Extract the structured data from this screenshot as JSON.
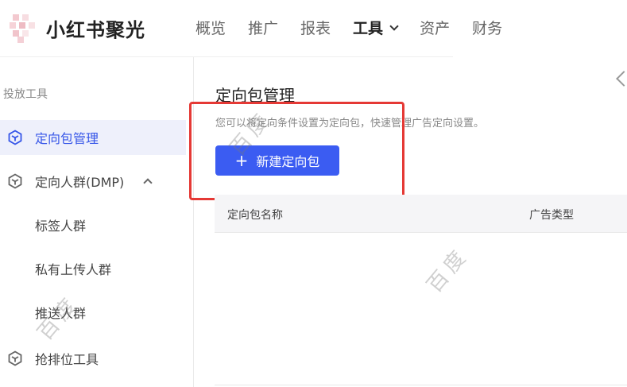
{
  "header": {
    "brand": "小红书聚光",
    "nav": [
      {
        "label": "概览",
        "active": false
      },
      {
        "label": "推广",
        "active": false
      },
      {
        "label": "报表",
        "active": false
      },
      {
        "label": "工具",
        "active": true,
        "has_dropdown": true
      },
      {
        "label": "资产",
        "active": false
      },
      {
        "label": "财务",
        "active": false
      }
    ]
  },
  "sidebar": {
    "section_title": "投放工具",
    "items": [
      {
        "label": "定向包管理",
        "icon": "hexagon-cube-icon",
        "active": true
      },
      {
        "label": "定向人群(DMP)",
        "icon": "hexagon-cube-icon",
        "expanded": true
      },
      {
        "label": "标签人群",
        "sub": true
      },
      {
        "label": "私有上传人群",
        "sub": true
      },
      {
        "label": "推送人群",
        "sub": true
      },
      {
        "label": "抢排位工具",
        "icon": "hexagon-cube-icon"
      }
    ]
  },
  "main": {
    "title": "定向包管理",
    "description": "您可以将定向条件设置为定向包，快速管理广告定向设置。",
    "new_button_label": "新建定向包",
    "table_columns": [
      "定向包名称",
      "广告类型"
    ]
  },
  "watermark": "百度",
  "colors": {
    "accent": "#3b5cf2",
    "active_bg": "#eef0fb",
    "highlight_border": "#e53935"
  }
}
